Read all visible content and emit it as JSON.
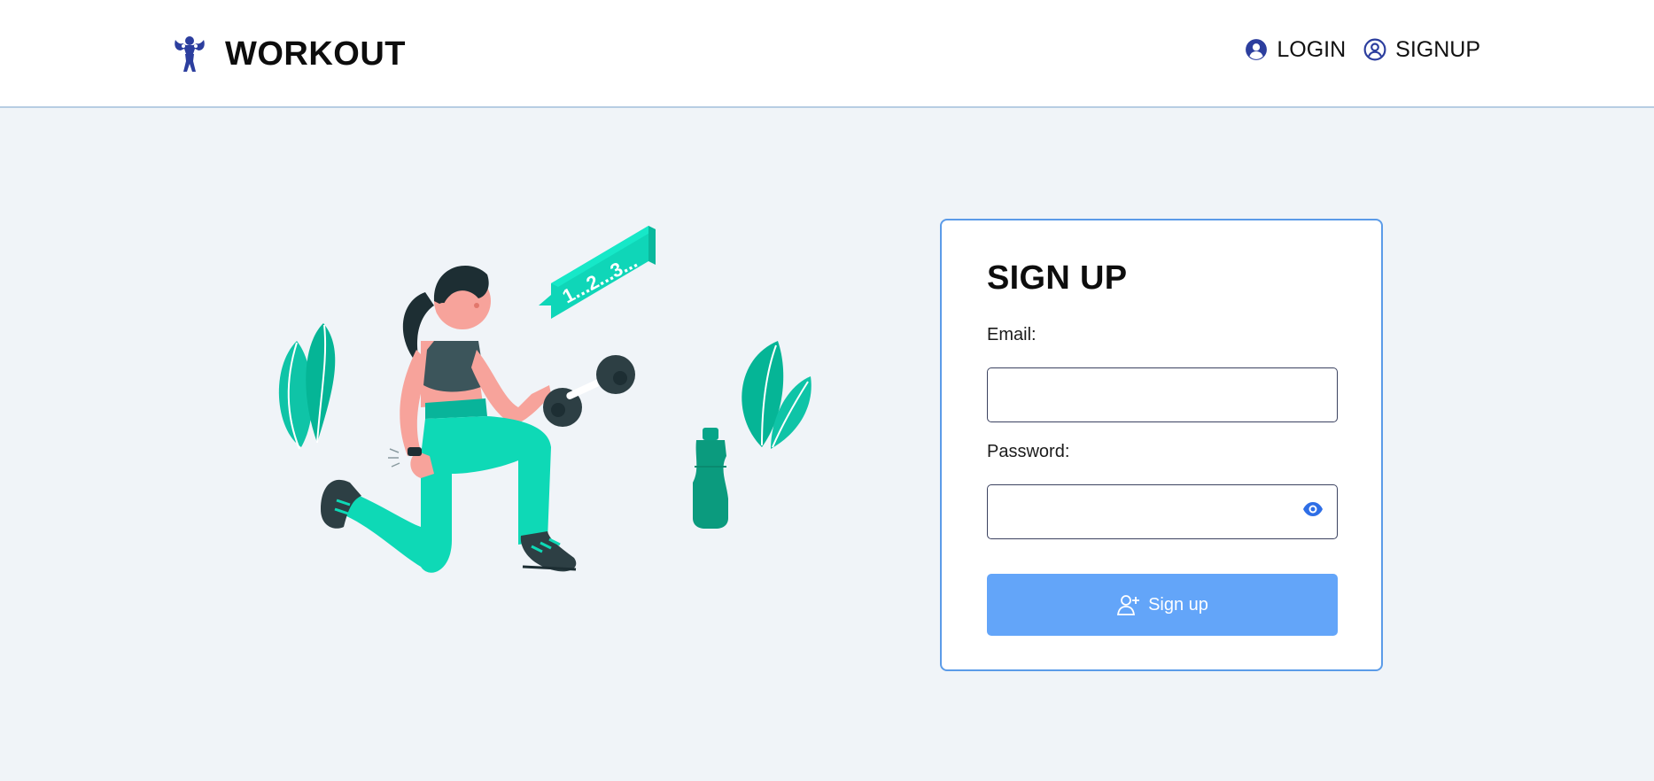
{
  "brand": {
    "name": "WORKOUT",
    "logo_icon": "flexing-bodybuilder-icon",
    "accent_color": "#2c3e9e"
  },
  "nav": {
    "items": [
      {
        "label": "LOGIN",
        "icon": "user-circle-filled-icon"
      },
      {
        "label": "SIGNUP",
        "icon": "user-circle-outline-icon"
      }
    ]
  },
  "illustration": {
    "counter_text": "1...2...3..."
  },
  "form": {
    "title": "SIGN UP",
    "email_label": "Email:",
    "email_value": "",
    "password_label": "Password:",
    "password_value": "",
    "submit_label": "Sign up",
    "submit_icon": "user-plus-icon",
    "submit_color": "#63a5f9",
    "card_border_color": "#5b9be8"
  }
}
